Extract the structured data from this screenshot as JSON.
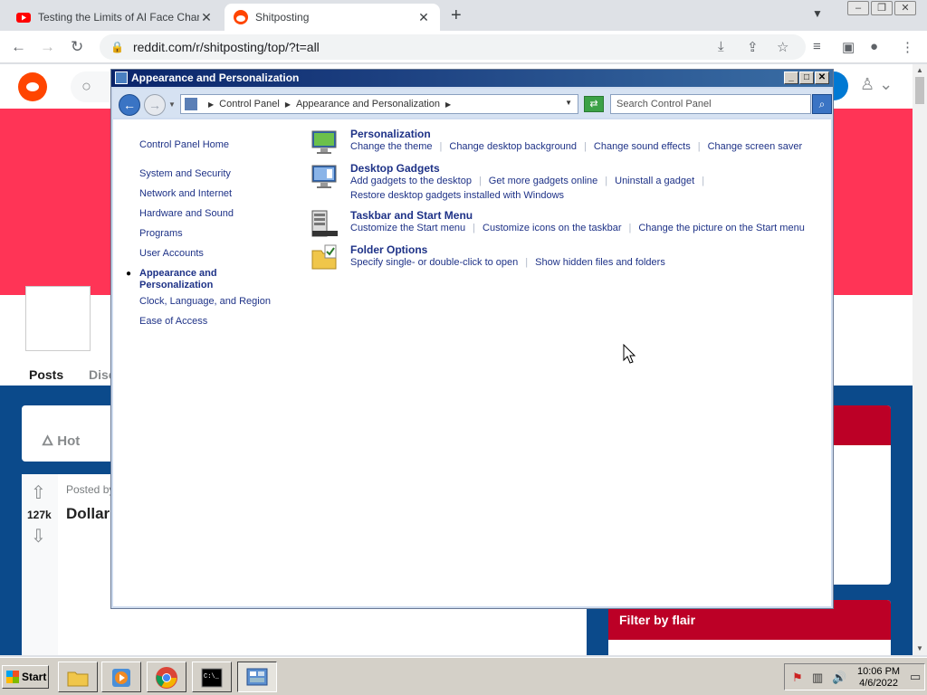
{
  "browser": {
    "tabs": [
      {
        "title": "Testing the Limits of AI Face Chang",
        "active": false,
        "icon": "youtube-icon"
      },
      {
        "title": "Shitposting",
        "active": true,
        "icon": "reddit-icon"
      }
    ],
    "url": "reddit.com/r/shitposting/top/?t=all"
  },
  "reddit": {
    "tabs": {
      "posts": "Posts",
      "discussions": "Disc"
    },
    "sort": "Hot",
    "post": {
      "votes": "127k",
      "posted_by": "Posted by",
      "title": "Dollar"
    },
    "filter_by_flair": "Filter by flair"
  },
  "control_panel": {
    "title": "Appearance and Personalization",
    "breadcrumb": [
      "Control Panel",
      "Appearance and Personalization"
    ],
    "search_placeholder": "Search Control Panel",
    "left_nav": {
      "home": "Control Panel Home",
      "items": [
        "System and Security",
        "Network and Internet",
        "Hardware and Sound",
        "Programs",
        "User Accounts"
      ],
      "current_line1": "Appearance and",
      "current_line2": "Personalization",
      "after": [
        "Clock, Language, and Region",
        "Ease of Access"
      ]
    },
    "categories": [
      {
        "title": "Personalization",
        "links": [
          "Change the theme",
          "Change desktop background",
          "Change sound effects",
          "Change screen saver"
        ]
      },
      {
        "title": "Desktop Gadgets",
        "links": [
          "Add gadgets to the desktop",
          "Get more gadgets online",
          "Uninstall a gadget"
        ],
        "links2": [
          "Restore desktop gadgets installed with Windows"
        ]
      },
      {
        "title": "Taskbar and Start Menu",
        "links": [
          "Customize the Start menu",
          "Customize icons on the taskbar",
          "Change the picture on the Start menu"
        ]
      },
      {
        "title": "Folder Options",
        "links": [
          "Specify single- or double-click to open",
          "Show hidden files and folders"
        ]
      }
    ]
  },
  "taskbar": {
    "start": "Start",
    "apps": [
      "file-explorer-icon",
      "media-player-icon",
      "chrome-icon",
      "command-prompt-icon",
      "control-panel-icon"
    ],
    "time": "10:06 PM",
    "date": "4/6/2022"
  }
}
